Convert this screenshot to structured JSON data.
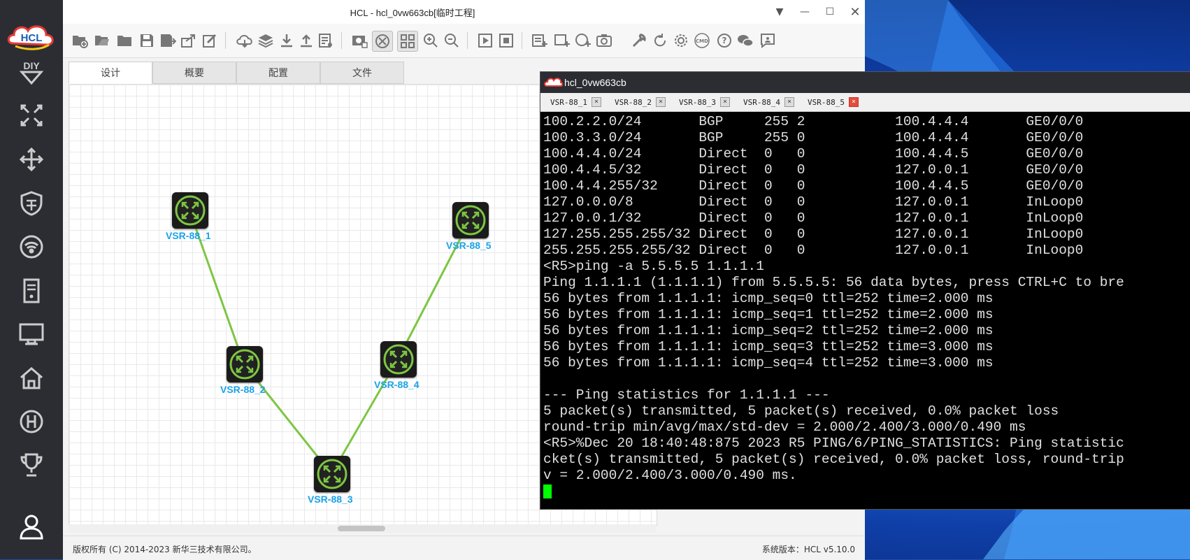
{
  "window": {
    "title": "HCL - hcl_0vw663cb[临时工程]",
    "app_logo": "HCL"
  },
  "sidebar": {
    "items": [
      {
        "icon": "diy-icon",
        "label": "DIY"
      },
      {
        "icon": "router-icon"
      },
      {
        "icon": "switch-icon"
      },
      {
        "icon": "firewall-icon"
      },
      {
        "icon": "wireless-icon"
      },
      {
        "icon": "server-icon"
      },
      {
        "icon": "monitor-icon"
      },
      {
        "icon": "home-icon"
      },
      {
        "icon": "h3c-icon"
      },
      {
        "icon": "trophy-icon"
      },
      {
        "icon": "user-icon"
      }
    ]
  },
  "tabs": [
    {
      "label": "设计",
      "active": true
    },
    {
      "label": "概要"
    },
    {
      "label": "配置"
    },
    {
      "label": "文件"
    }
  ],
  "topology": {
    "nodes": [
      {
        "id": "n1",
        "label": "VSR-88_1"
      },
      {
        "id": "n2",
        "label": "VSR-88_2"
      },
      {
        "id": "n3",
        "label": "VSR-88_3"
      },
      {
        "id": "n4",
        "label": "VSR-88_4"
      },
      {
        "id": "n5",
        "label": "VSR-88_5"
      }
    ],
    "link_color": "#7dc642"
  },
  "status": {
    "copyright": "版权所有 (C) 2014-2023 新华三技术有限公司。",
    "version": "系统版本：HCL v5.10.0"
  },
  "terminal": {
    "title": "hcl_0vw663cb",
    "tabs": [
      "VSR-88_1",
      "VSR-88_2",
      "VSR-88_3",
      "VSR-88_4",
      "VSR-88_5"
    ],
    "active_tab": "VSR-88_5",
    "lines": [
      "100.2.2.0/24       BGP     255 2           100.4.4.4       GE0/0/0",
      "100.3.3.0/24       BGP     255 0           100.4.4.4       GE0/0/0",
      "100.4.4.0/24       Direct  0   0           100.4.4.5       GE0/0/0",
      "100.4.4.5/32       Direct  0   0           127.0.0.1       GE0/0/0",
      "100.4.4.255/32     Direct  0   0           100.4.4.5       GE0/0/0",
      "127.0.0.0/8        Direct  0   0           127.0.0.1       InLoop0",
      "127.0.0.1/32       Direct  0   0           127.0.0.1       InLoop0",
      "127.255.255.255/32 Direct  0   0           127.0.0.1       InLoop0",
      "255.255.255.255/32 Direct  0   0           127.0.0.1       InLoop0",
      "<R5>ping -a 5.5.5.5 1.1.1.1",
      "Ping 1.1.1.1 (1.1.1.1) from 5.5.5.5: 56 data bytes, press CTRL+C to bre",
      "56 bytes from 1.1.1.1: icmp_seq=0 ttl=252 time=2.000 ms",
      "56 bytes from 1.1.1.1: icmp_seq=1 ttl=252 time=2.000 ms",
      "56 bytes from 1.1.1.1: icmp_seq=2 ttl=252 time=2.000 ms",
      "56 bytes from 1.1.1.1: icmp_seq=3 ttl=252 time=3.000 ms",
      "56 bytes from 1.1.1.1: icmp_seq=4 ttl=252 time=3.000 ms",
      "",
      "--- Ping statistics for 1.1.1.1 ---",
      "5 packet(s) transmitted, 5 packet(s) received, 0.0% packet loss",
      "round-trip min/avg/max/std-dev = 2.000/2.400/3.000/0.490 ms",
      "<R5>%Dec 20 18:40:48:875 2023 R5 PING/6/PING_STATISTICS: Ping statistic",
      "cket(s) transmitted, 5 packet(s) received, 0.0% packet loss, round-trip",
      "v = 2.000/2.400/3.000/0.490 ms."
    ]
  }
}
